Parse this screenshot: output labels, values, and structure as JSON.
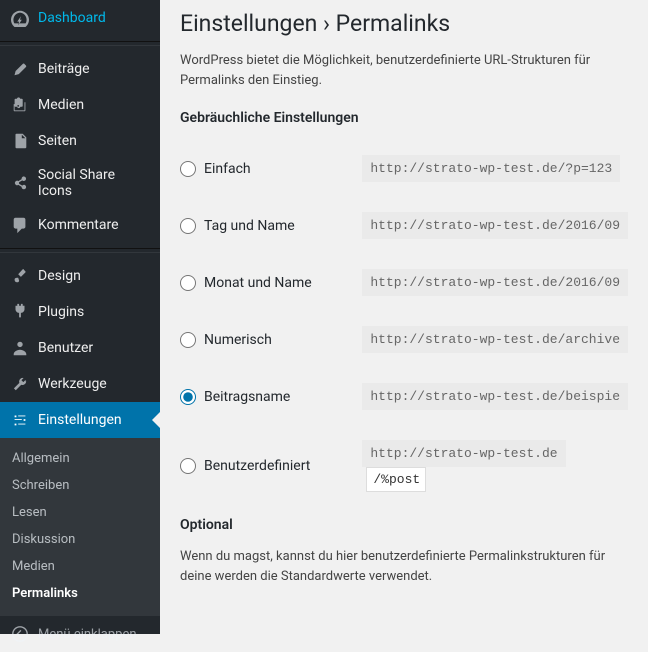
{
  "sidebar": {
    "items": [
      {
        "label": "Dashboard"
      },
      {
        "label": "Beiträge"
      },
      {
        "label": "Medien"
      },
      {
        "label": "Seiten"
      },
      {
        "label": "Social Share Icons"
      },
      {
        "label": "Kommentare"
      },
      {
        "label": "Design"
      },
      {
        "label": "Plugins"
      },
      {
        "label": "Benutzer"
      },
      {
        "label": "Werkzeuge"
      },
      {
        "label": "Einstellungen"
      }
    ],
    "submenu": [
      {
        "label": "Allgemein"
      },
      {
        "label": "Schreiben"
      },
      {
        "label": "Lesen"
      },
      {
        "label": "Diskussion"
      },
      {
        "label": "Medien"
      },
      {
        "label": "Permalinks"
      }
    ],
    "collapse": "Menü einklappen"
  },
  "page": {
    "title": "Einstellungen › Permalinks",
    "intro": "WordPress bietet die Möglichkeit, benutzerdefinierte URL-Strukturen für Permalinks den Einstieg.",
    "section_common": "Gebräuchliche Einstellungen",
    "options": [
      {
        "label": "Einfach",
        "example": "http://strato-wp-test.de/?p=123"
      },
      {
        "label": "Tag und Name",
        "example": "http://strato-wp-test.de/2016/09"
      },
      {
        "label": "Monat und Name",
        "example": "http://strato-wp-test.de/2016/09"
      },
      {
        "label": "Numerisch",
        "example": "http://strato-wp-test.de/archive"
      },
      {
        "label": "Beitragsname",
        "example": "http://strato-wp-test.de/beispie"
      },
      {
        "label": "Benutzerdefiniert",
        "example": "http://strato-wp-test.de",
        "custom_value": "/%post"
      }
    ],
    "selected_index": 4,
    "section_optional": "Optional",
    "optional_text": "Wenn du magst, kannst du hier benutzerdefinierte Permalinkstrukturen für deine werden die Standardwerte verwendet."
  }
}
